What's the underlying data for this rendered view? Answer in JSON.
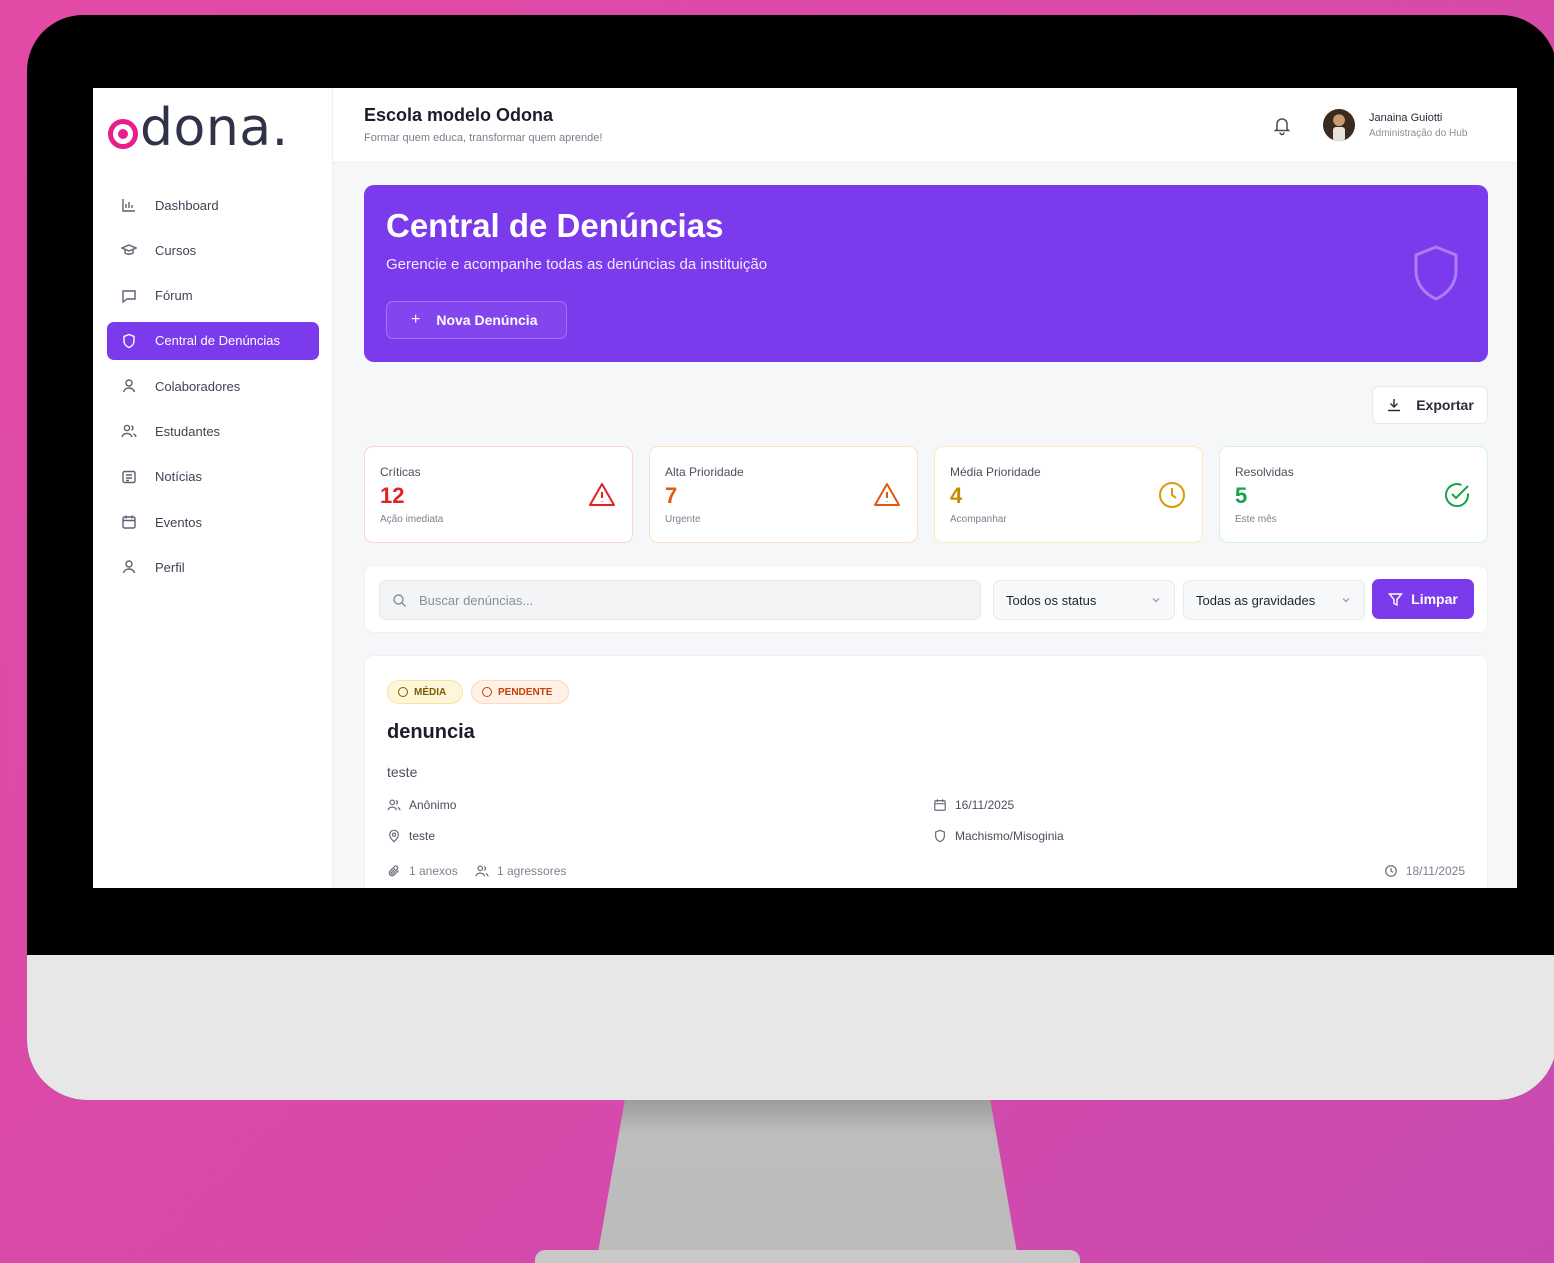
{
  "brand": {
    "logo_text": "dona.",
    "accent": "#7c3aed",
    "logo_color": "#e91e8c"
  },
  "header": {
    "org_title": "Escola modelo Odona",
    "org_subtitle": "Formar quem educa, transformar quem aprende!",
    "user_name": "Janaina Guiotti",
    "user_role": "Administração do Hub"
  },
  "sidebar": {
    "items": [
      {
        "label": "Dashboard",
        "icon": "bar-chart-icon"
      },
      {
        "label": "Cursos",
        "icon": "graduation-cap-icon"
      },
      {
        "label": "Fórum",
        "icon": "message-square-icon"
      },
      {
        "label": "Central de Denúncias",
        "icon": "shield-icon",
        "active": true
      },
      {
        "label": "Colaboradores",
        "icon": "user-icon"
      },
      {
        "label": "Estudantes",
        "icon": "users-icon"
      },
      {
        "label": "Notícias",
        "icon": "newspaper-icon"
      },
      {
        "label": "Eventos",
        "icon": "calendar-icon"
      },
      {
        "label": "Perfil",
        "icon": "user-icon"
      }
    ]
  },
  "banner": {
    "title": "Central de Denúncias",
    "subtitle": "Gerencie e acompanhe todas as denúncias da instituição",
    "new_button": "Nova Denúncia"
  },
  "export_label": "Exportar",
  "stats": [
    {
      "label": "Críticas",
      "value": "12",
      "sub": "Ação imediata",
      "icon": "alert-triangle-icon",
      "color": "#e02424"
    },
    {
      "label": "Alta Prioridade",
      "value": "7",
      "sub": "Urgente",
      "icon": "alert-triangle-icon",
      "color": "#e05a12"
    },
    {
      "label": "Média Prioridade",
      "value": "4",
      "sub": "Acompanhar",
      "icon": "clock-icon",
      "color": "#c98a04"
    },
    {
      "label": "Resolvidas",
      "value": "5",
      "sub": "Este mês",
      "icon": "check-circle-icon",
      "color": "#16a34a"
    }
  ],
  "filters": {
    "search_placeholder": "Buscar denúncias...",
    "status_selected": "Todos os status",
    "gravity_selected": "Todas as gravidades",
    "clear_label": "Limpar"
  },
  "report": {
    "badge_severity": "MÉDIA",
    "badge_status": "PENDENTE",
    "title": "denuncia",
    "description": "teste",
    "author": "Anônimo",
    "location": "teste",
    "date": "16/11/2025",
    "category": "Machismo/Misoginia",
    "attachments": "1 anexos",
    "aggressors": "1 agressores",
    "updated": "18/11/2025"
  }
}
